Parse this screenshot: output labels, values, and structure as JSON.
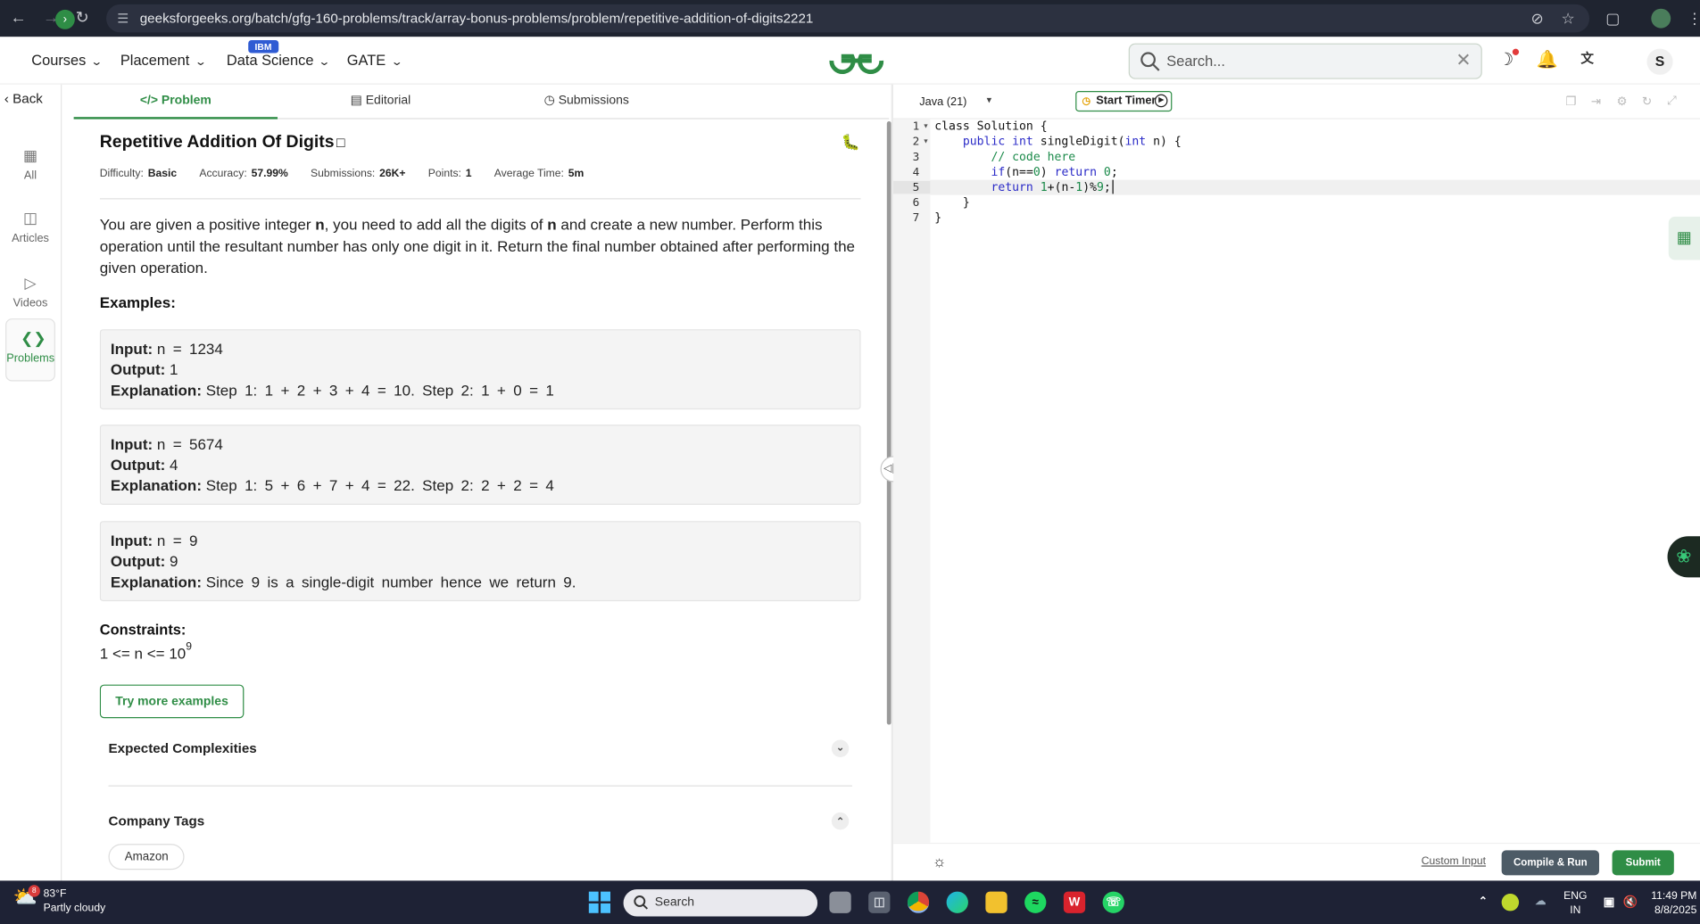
{
  "browser": {
    "url": "geeksforgeeks.org/batch/gfg-160-problems/track/array-bonus-problems/problem/repetitive-addition-of-digits2221"
  },
  "header": {
    "nav": [
      {
        "label": "Courses"
      },
      {
        "label": "Placement"
      },
      {
        "label": "Data Science",
        "badge": "IBM"
      },
      {
        "label": "GATE"
      }
    ],
    "logo": "GfG",
    "search_placeholder": "Search...",
    "avatar_letter": "S"
  },
  "rail": {
    "back_label": "Back",
    "items": [
      {
        "label": "All",
        "icon": "grid-icon"
      },
      {
        "label": "Articles",
        "icon": "book-icon"
      },
      {
        "label": "Videos",
        "icon": "play-icon"
      },
      {
        "label": "Problems",
        "icon": "code-icon",
        "active": true
      }
    ]
  },
  "tabs": [
    {
      "label": "Problem",
      "icon": "</>",
      "active": true
    },
    {
      "label": "Editorial",
      "icon": "doc-icon"
    },
    {
      "label": "Submissions",
      "icon": "clock-icon"
    }
  ],
  "problem": {
    "title": "Repetitive Addition Of Digits",
    "meta": {
      "difficulty_label": "Difficulty:",
      "difficulty": "Basic",
      "accuracy_label": "Accuracy:",
      "accuracy": "57.99%",
      "submissions_label": "Submissions:",
      "submissions": "26K+",
      "points_label": "Points:",
      "points": "1",
      "avg_time_label": "Average Time:",
      "avg_time": "5m"
    },
    "description": {
      "p1": "You are given a positive integer ",
      "n1": "n",
      "p2": ", you need to add all the digits of ",
      "n2": "n",
      "p3": " and create a new number. Perform this operation until the resultant number has only one digit in it. Return the final number obtained after performing the given operation."
    },
    "examples_heading": "Examples:",
    "examples": [
      {
        "input_label": "Input:",
        "input": "n = 1234",
        "output_label": "Output:",
        "output": "1",
        "explanation_label": "Explanation:",
        "explanation": "Step 1: 1 + 2 + 3 + 4 = 10. Step 2: 1 + 0 = 1"
      },
      {
        "input_label": "Input:",
        "input": "n = 5674",
        "output_label": "Output:",
        "output": "4",
        "explanation_label": "Explanation:",
        "explanation": "Step 1: 5 + 6 + 7 + 4 = 22. Step 2: 2 + 2 = 4"
      },
      {
        "input_label": "Input:",
        "input": "n = 9",
        "output_label": "Output:",
        "output": "9",
        "explanation_label": "Explanation:",
        "explanation": "Since 9 is a single-digit number hence we return 9."
      }
    ],
    "constraints_heading": "Constraints:",
    "constraint_base": "1 <= n <= 10",
    "constraint_exp": "9",
    "try_more": "Try more examples",
    "expected_complexities": "Expected Complexities",
    "company_tags": "Company Tags",
    "tags": [
      "Amazon"
    ]
  },
  "editor": {
    "language": "Java (21)",
    "timer_label": "Start Timer",
    "lines": [
      "1",
      "2",
      "3",
      "4",
      "5",
      "6",
      "7"
    ],
    "code": {
      "l1": "class Solution {",
      "l2a": "    public int ",
      "l2b": "singleDigit(",
      "l2c": "int",
      "l2d": " n) {",
      "l3": "        // code here",
      "l4a": "        if",
      "l4b": "(n==",
      "l4c": "0",
      "l4d": ") ",
      "l4e": "return",
      "l4f": " ",
      "l4g": "0",
      "l4h": ";",
      "l5a": "        return",
      "l5b": " ",
      "l5c": "1",
      "l5d": "+(n-",
      "l5e": "1",
      "l5f": ")%",
      "l5g": "9",
      "l5h": ";",
      "l6": "    }",
      "l7": "}"
    },
    "custom_input": "Custom Input",
    "compile_run": "Compile & Run",
    "submit": "Submit"
  },
  "taskbar": {
    "weather_temp": "83°F",
    "weather_desc": "Partly cloudy",
    "weather_badge": "8",
    "search": "Search",
    "lang_top": "ENG",
    "lang_bottom": "IN",
    "time": "11:49 PM",
    "date": "8/8/2025"
  },
  "colors": {
    "gfg_green": "#2f8d46",
    "compile_gray": "#4d5b66",
    "taskbar": "#1e2235"
  }
}
